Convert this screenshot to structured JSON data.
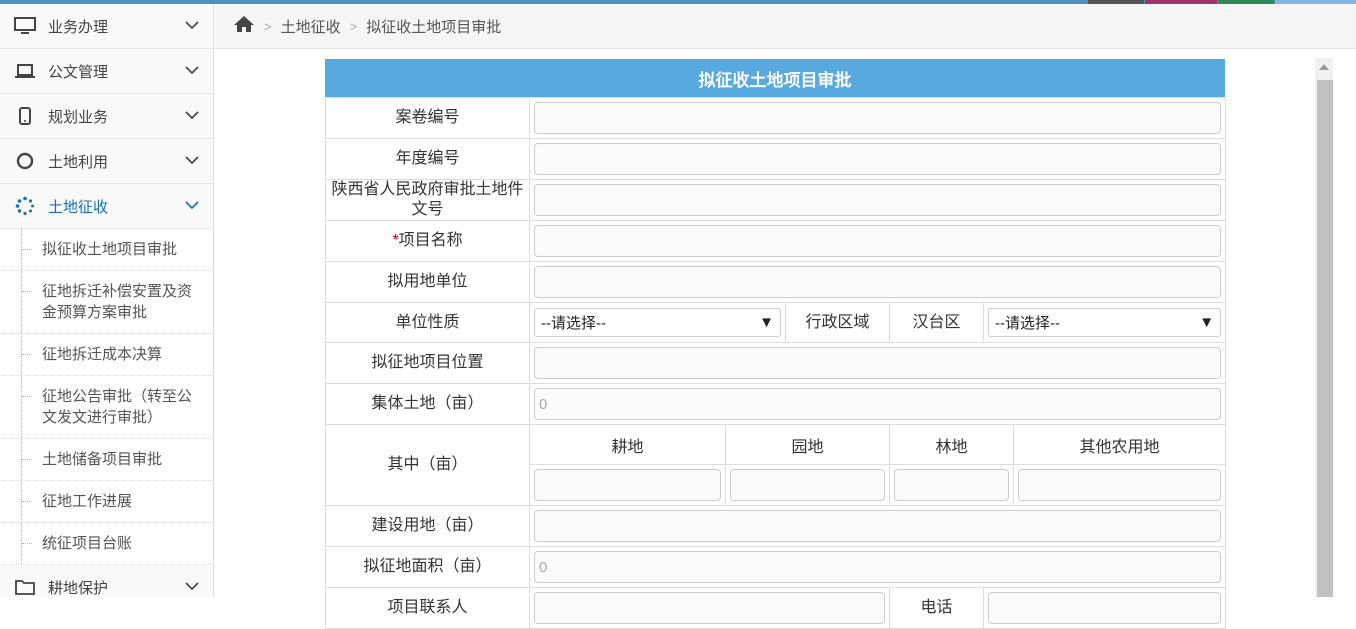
{
  "colors": {
    "accent": "#58a9df",
    "active": "#1a6fb5",
    "required": "#cc0000"
  },
  "sidebar": {
    "items": [
      {
        "label": "业务办理",
        "icon": "monitor-icon"
      },
      {
        "label": "公文管理",
        "icon": "laptop-icon"
      },
      {
        "label": "规划业务",
        "icon": "tablet-icon"
      },
      {
        "label": "土地利用",
        "icon": "circle-icon"
      },
      {
        "label": "土地征收",
        "icon": "spinner-icon",
        "active": true
      }
    ],
    "submenu": [
      "拟征收土地项目审批",
      "征地拆迁补偿安置及资金预算方案审批",
      "征地拆迁成本决算",
      "征地公告审批（转至公文发文进行审批）",
      "土地储备项目审批",
      "征地工作进展",
      "统征项目台账"
    ],
    "after": [
      {
        "label": "耕地保护",
        "icon": "folder-icon"
      }
    ]
  },
  "breadcrumb": {
    "home_icon": "home-icon",
    "level1": "土地征收",
    "level2": "拟征收土地项目审批"
  },
  "form": {
    "title": "拟征收土地项目审批",
    "fields": {
      "case_no": "案卷编号",
      "year_no": "年度编号",
      "approval_doc": "陕西省人民政府审批土地件文号",
      "required_mark": "*",
      "project_name": "项目名称",
      "unit": "拟用地单位",
      "unit_nature": "单位性质",
      "unit_nature_value": "--请选择--",
      "district_label": "行政区域",
      "district_value": "汉台区",
      "district_select": "--请选择--",
      "location": "拟征地项目位置",
      "collective_land": "集体土地（亩）",
      "collective_land_value": "0",
      "of_which": "其中（亩）",
      "farmland": "耕地",
      "garden": "园地",
      "forest": "林地",
      "other_agri": "其他农用地",
      "construction_land": "建设用地（亩）",
      "total_area": "拟征地面积（亩）",
      "total_area_value": "0",
      "contact": "项目联系人",
      "phone": "电话"
    }
  }
}
